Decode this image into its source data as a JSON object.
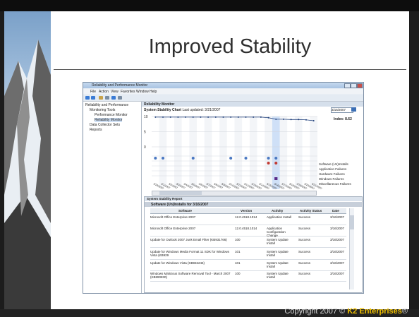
{
  "slide": {
    "title": "Improved Stability",
    "copyright_prefix": "Copyright 2007 © ",
    "copyright_brand": "K2 Enterprises",
    "copyright_mark": "®"
  },
  "window": {
    "title": "Reliability and Performance Monitor",
    "menu": [
      "File",
      "Action",
      "View",
      "Favorites",
      "Window",
      "Help"
    ],
    "nav": {
      "root": "Reliability and Performance",
      "monitoring_tools": "Monitoring Tools",
      "performance_monitor": "Performance Monitor",
      "reliability_monitor": "Reliability Monitor",
      "data_collector_sets": "Data Collector Sets",
      "reports": "Reports"
    },
    "panel_title": "Reliability Monitor",
    "chart_heading": "System Stability Chart",
    "last_updated": "Last updated: 3/21/2007",
    "selected_date": "3/16/2007",
    "index": "Index: 8.62",
    "legend": [
      "Software (Un)Installs",
      "Application Failures",
      "Hardware Failures",
      "Windows Failures",
      "Miscellaneous Failures"
    ]
  },
  "chart_data": {
    "type": "line",
    "ylim": [
      0,
      10
    ],
    "yticks": [
      "10",
      "5",
      "0"
    ],
    "x": [
      "2/28/2007",
      "3/1/2007",
      "3/2/2007",
      "3/3/2007",
      "3/4/2007",
      "3/5/2007",
      "3/6/2007",
      "3/7/2007",
      "3/8/2007",
      "3/9/2007",
      "3/10/2007",
      "3/11/2007",
      "3/12/2007",
      "3/13/2007",
      "3/14/2007",
      "3/15/2007",
      "3/16/2007",
      "3/17/2007",
      "3/18/2007",
      "3/19/2007",
      "3/20/2007",
      "3/21/2007"
    ],
    "series": [
      {
        "values": [
          9.8,
          9.8,
          9.8,
          9.8,
          9.8,
          9.8,
          9.8,
          9.8,
          9.8,
          9.8,
          9.8,
          9.8,
          9.8,
          9.8,
          9.8,
          9.6,
          9.1,
          9.1,
          9.0,
          9.0,
          8.9,
          8.6
        ]
      }
    ],
    "selected_index": 16
  },
  "report": {
    "title": "System Stability Report",
    "subtitle": "Software (Un)Installs for 3/16/2007",
    "columns": [
      "Software",
      "Version",
      "Activity",
      "Activity Status",
      "Date"
    ],
    "rows": [
      {
        "software": "Microsoft Office Enterprise 2007",
        "version": "12.0.4518.1014",
        "activity": "Application Install",
        "status": "Success",
        "date": "3/16/2007"
      },
      {
        "software": "Microsoft Office Enterprise 2007",
        "version": "12.0.4518.1014",
        "activity": "Application Configuration Change",
        "status": "Success",
        "date": "3/16/2007"
      },
      {
        "software": "Update for Outlook 2007 Junk Email Filter (KB931766)",
        "version": "100",
        "activity": "System Update Install",
        "status": "Success",
        "date": "3/16/2007"
      },
      {
        "software": "Update for Windows Media Format 11 SDK for Windows Vista (KB929",
        "version": "101",
        "activity": "System Update Install",
        "status": "Success",
        "date": "3/16/2007"
      },
      {
        "software": "Update for Windows Vista (KB932246)",
        "version": "101",
        "activity": "System Update Install",
        "status": "Success",
        "date": "3/16/2007"
      },
      {
        "software": "Windows Malicious Software Removal Tool - March 2007 (KB890830)",
        "version": "100",
        "activity": "System Update Install",
        "status": "Success",
        "date": "3/16/2007"
      }
    ]
  }
}
